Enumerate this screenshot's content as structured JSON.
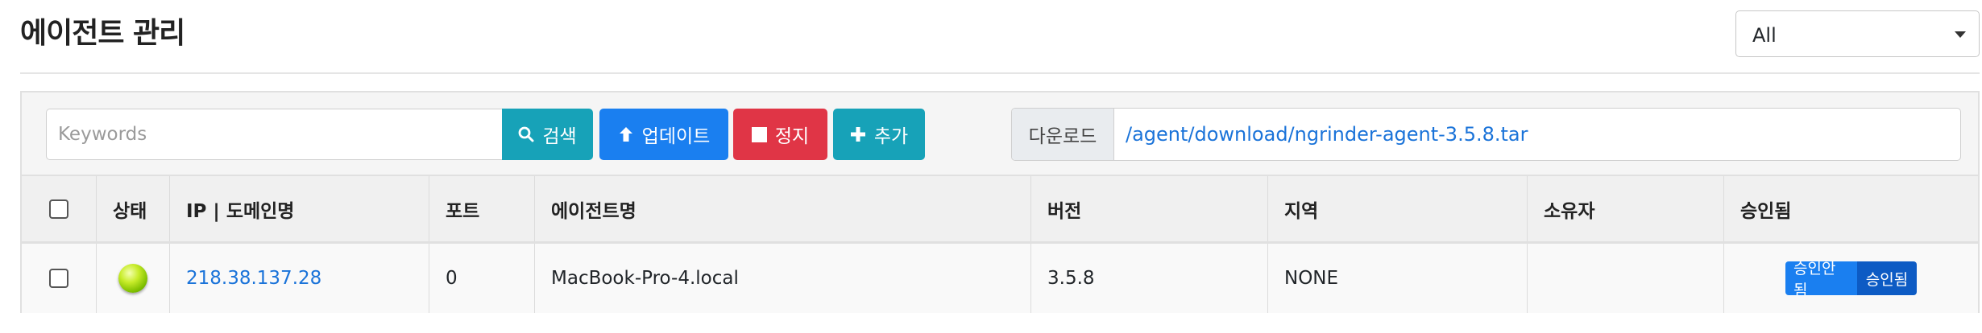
{
  "page": {
    "title": "에이전트 관리"
  },
  "region_filter": {
    "selected": "All"
  },
  "toolbar": {
    "search_placeholder": "Keywords",
    "search_label": "검색",
    "update_label": "업데이트",
    "stop_label": "정지",
    "add_label": "추가"
  },
  "download": {
    "label": "다운로드",
    "link": "/agent/download/ngrinder-agent-3.5.8.tar"
  },
  "table": {
    "headers": {
      "status": "상태",
      "ip": "IP | 도메인명",
      "port": "포트",
      "name": "에이전트명",
      "version": "버전",
      "region": "지역",
      "owner": "소유자",
      "approved": "승인됨"
    },
    "rows": [
      {
        "checked": false,
        "status": "ready",
        "ip": "218.38.137.28",
        "port": "0",
        "name": "MacBook-Pro-4.local",
        "version": "3.5.8",
        "region": "NONE",
        "owner": "",
        "approve_off_label": "승인안됨",
        "approve_on_label": "승인됨"
      }
    ]
  },
  "colors": {
    "primary": "#1a7ff0",
    "info": "#17a2b8",
    "danger": "#e03546",
    "approved_active": "#0d5bc4",
    "link": "#1a73d9",
    "status_ready": "#9ad000"
  },
  "icons": {
    "search": "search-icon",
    "update": "arrow-up-icon",
    "stop": "stop-icon",
    "add": "plus-icon",
    "dropdown": "caret-down-icon",
    "status": "status-ready-icon"
  }
}
